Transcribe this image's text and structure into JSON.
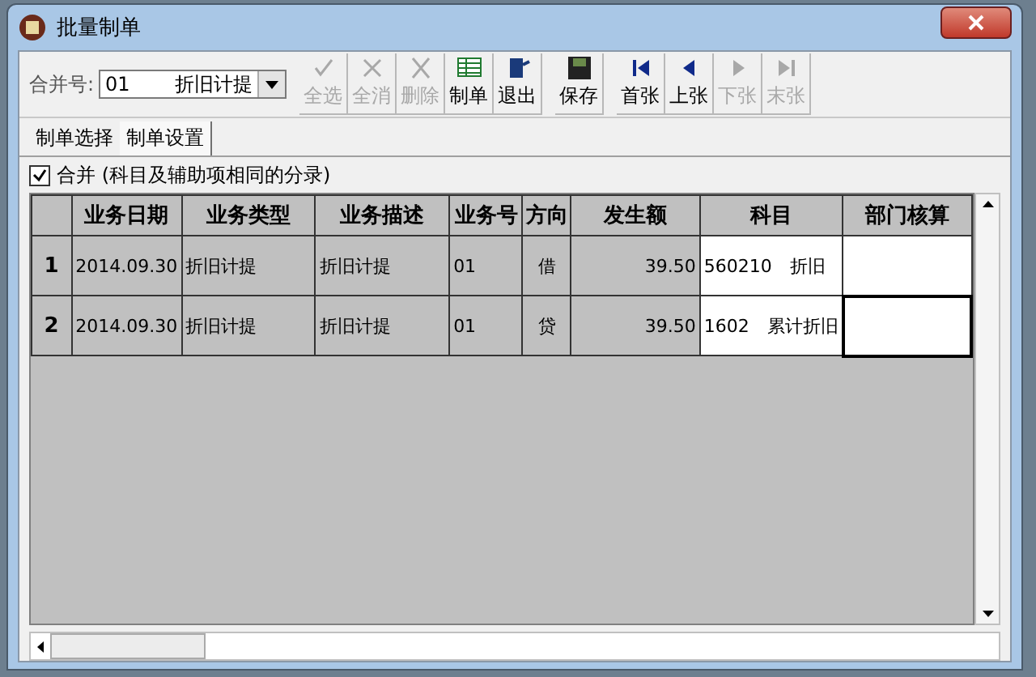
{
  "window": {
    "title": "批量制单"
  },
  "toolbar": {
    "merge_label": "合并号:",
    "combo": {
      "code": "01",
      "name": "折旧计提"
    },
    "buttons": [
      {
        "label": "全选",
        "disabled": true
      },
      {
        "label": "全消",
        "disabled": true
      },
      {
        "label": "删除",
        "disabled": true
      },
      {
        "label": "制单",
        "disabled": false
      },
      {
        "label": "退出",
        "disabled": false
      },
      {
        "label": "保存",
        "disabled": false
      },
      {
        "label": "首张",
        "disabled": false
      },
      {
        "label": "上张",
        "disabled": false
      },
      {
        "label": "下张",
        "disabled": true
      },
      {
        "label": "末张",
        "disabled": true
      }
    ]
  },
  "tabs": [
    {
      "label": "制单选择",
      "selected": false
    },
    {
      "label": "制单设置",
      "selected": true
    }
  ],
  "merge_option": {
    "label": "合并 (科目及辅助项相同的分录)",
    "checked": true
  },
  "table": {
    "columns": [
      {
        "label": "业务日期",
        "editable": false
      },
      {
        "label": "业务类型",
        "editable": false
      },
      {
        "label": "业务描述",
        "editable": false
      },
      {
        "label": "业务号",
        "editable": false
      },
      {
        "label": "方向",
        "editable": false
      },
      {
        "label": "发生额",
        "editable": false
      },
      {
        "label": "科目",
        "editable": true
      },
      {
        "label": "部门核算",
        "editable": true
      }
    ],
    "rows": [
      {
        "number": "1",
        "focused": false,
        "cells": [
          "2014.09.30",
          "折旧计提",
          "折旧计提",
          "01",
          "借",
          "39.50",
          "560210　折旧",
          ""
        ]
      },
      {
        "number": "2",
        "focused": true,
        "cells": [
          "2014.09.30",
          "折旧计提",
          "折旧计提",
          "01",
          "贷",
          "39.50",
          "1602　累计折旧",
          ""
        ]
      }
    ]
  }
}
